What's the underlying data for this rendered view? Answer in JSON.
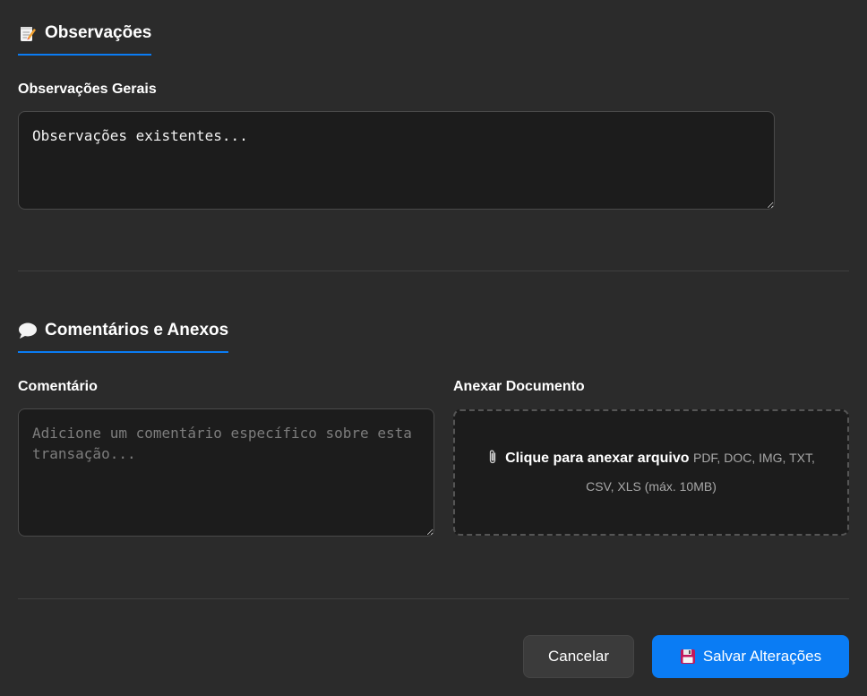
{
  "observations": {
    "heading": "Observações",
    "heading_icon": "memo-icon",
    "general_label": "Observações Gerais",
    "general_value": "Observações existentes..."
  },
  "comments": {
    "heading": "Comentários e Anexos",
    "heading_icon": "speech-bubble-icon",
    "comment_label": "Comentário",
    "comment_placeholder": "Adicione um comentário específico sobre esta transação...",
    "attach_label": "Anexar Documento",
    "attach_icon": "paperclip-icon",
    "attach_main": "Clique para anexar arquivo",
    "attach_formats": "PDF, DOC, IMG, TXT, CSV, XLS (máx. 10MB)"
  },
  "actions": {
    "cancel_label": "Cancelar",
    "save_label": "Salvar Alterações",
    "save_icon": "floppy-disk-icon"
  },
  "colors": {
    "background": "#2b2b2b",
    "field_background": "#1c1c1c",
    "accent": "#0a7cf4"
  }
}
